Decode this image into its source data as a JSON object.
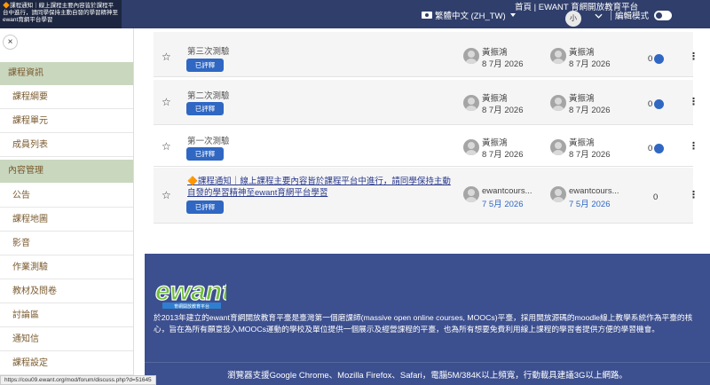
{
  "navbar": {
    "notice": "🔶課程通知｜線上課程主要內容皆於課程平台中進行，請同學保持主動自發的學習精神至ewant育網平台學習",
    "language": "繁體中文 (ZH_TW)",
    "home": "首頁 | EWANT 育網開放教育平台",
    "avatar": "小",
    "edit_mode": "編輯模式"
  },
  "sidebar": {
    "close": "×",
    "section_info": "課程資訊",
    "info_items": [
      "課程綱要",
      "課程單元",
      "成員列表"
    ],
    "section_manage": "內容管理",
    "manage_items": [
      "公告",
      "課程地圖",
      "影音",
      "作業測驗",
      "教材及問卷",
      "討論區",
      "通知信",
      "課程設定"
    ]
  },
  "rows": [
    {
      "title": "第三次測驗",
      "badge": "已評釋",
      "author": "黃振鴻",
      "author_date": "8 7月 2026",
      "last": "黃振鴻",
      "last_date": "8 7月 2026",
      "count": "0"
    },
    {
      "title": "第二次測驗",
      "badge": "已評釋",
      "author": "黃振鴻",
      "author_date": "8 7月 2026",
      "last": "黃振鴻",
      "last_date": "8 7月 2026",
      "count": "0"
    },
    {
      "title": "第一次測驗",
      "badge": "已評釋",
      "author": "黃振鴻",
      "author_date": "8 7月 2026",
      "last": "黃振鴻",
      "last_date": "8 7月 2026",
      "count": "0"
    },
    {
      "title": "🔶課程通知｜線上課程主要內容皆於課程平台中進行，請同學保持主動自發的學習精神至ewant育網平台學習",
      "badge": "已評釋",
      "author": "ewantcours...",
      "author_date": "7 5月 2026",
      "last": "ewantcours...",
      "last_date": "7 5月 2026",
      "count": "0"
    }
  ],
  "footer": {
    "logo_text": "ewant",
    "logo_sub": "育網開放教育平台",
    "description": "於2013年建立的ewant育網開放教育平臺是臺灣第一個磨課師(massive open online courses, MOOCs)平臺，採用開放源碼的moodle線上教學系統作為平臺的核心，旨在為所有願意投入MOOCs運動的學校及單位提供一個展示及經營課程的平臺，也為所有想要免費利用線上課程的學習者提供方便的學習機會。",
    "browser_note": "瀏覽器支援Google Chrome、Mozilla Firefox、Safari，電腦5M/384K以上頻寬，行動載具建議3G以上網路。"
  },
  "statusbar": "https://cou09.ewant.org/mod/forum/discuss.php?d=51645",
  "colors": {
    "navbar": "#2f3e6b",
    "accent": "#2f67c3",
    "footer": "#3c4f8f",
    "sidebar_section": "#c9d7bf"
  }
}
